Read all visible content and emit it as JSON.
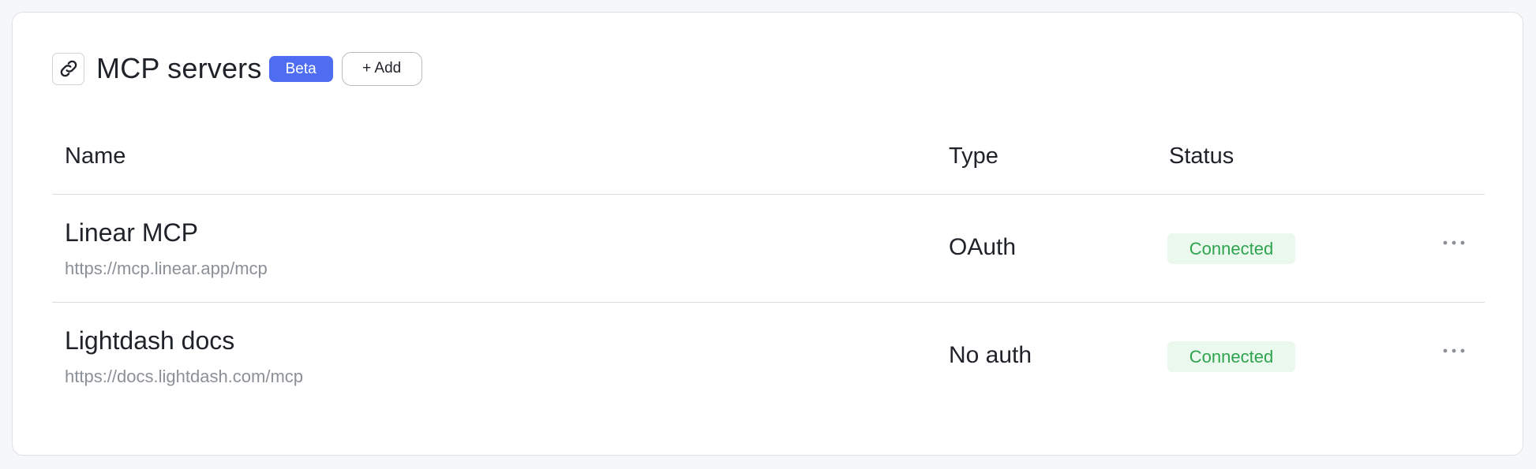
{
  "header": {
    "icon": "link-icon",
    "title": "MCP servers",
    "badge": "Beta",
    "add_label": "+ Add"
  },
  "table": {
    "columns": [
      "Name",
      "Type",
      "Status"
    ],
    "rows": [
      {
        "name": "Linear MCP",
        "url": "https://mcp.linear.app/mcp",
        "type": "OAuth",
        "status": "Connected"
      },
      {
        "name": "Lightdash docs",
        "url": "https://docs.lightdash.com/mcp",
        "type": "No auth",
        "status": "Connected"
      }
    ]
  },
  "colors": {
    "accent": "#4f6df0",
    "status_text": "#2fa44f",
    "status_bg": "#ebf8ee"
  }
}
